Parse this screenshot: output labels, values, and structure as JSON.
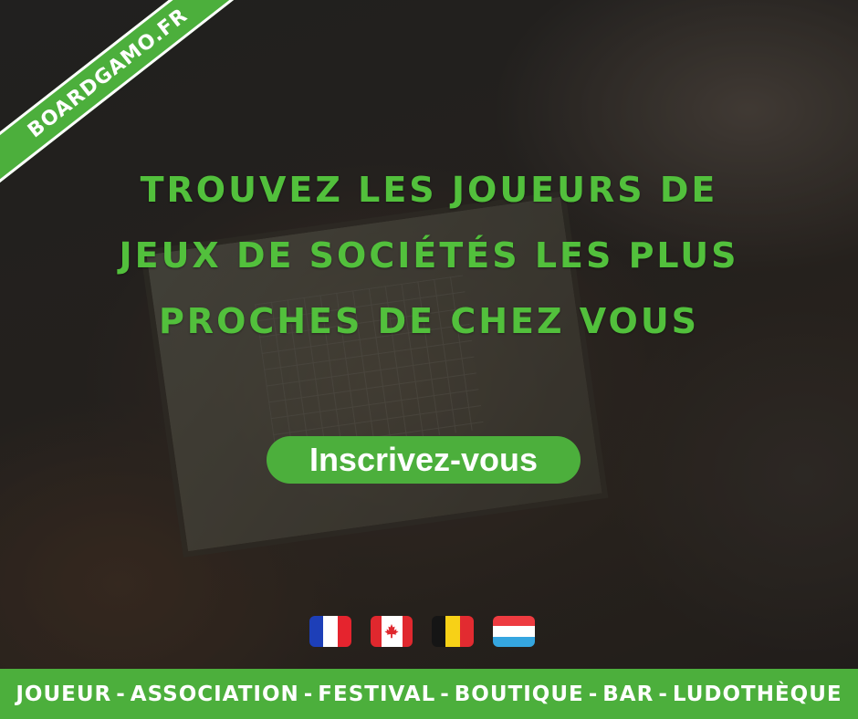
{
  "ribbon": {
    "text": "BOARDGAMO.FR"
  },
  "headline": {
    "lines": [
      "TROUVEZ LES JOUEURS DE",
      "JEUX DE SOCIÉTÉS LES PLUS",
      "PROCHES DE CHEZ VOUS"
    ]
  },
  "cta": {
    "label": "Inscrivez-vous"
  },
  "flags": [
    "flag-france-icon",
    "flag-canada-icon",
    "flag-belgium-icon",
    "flag-luxembourg-icon"
  ],
  "bottom_bar": {
    "items": [
      "JOUEUR",
      "ASSOCIATION",
      "FESTIVAL",
      "BOUTIQUE",
      "BAR",
      "LUDOTHÈQUE"
    ],
    "separator": "-"
  },
  "colors": {
    "accent_green": "#4caf3c",
    "headline_green": "#52c03c",
    "text_white": "#ffffff"
  }
}
